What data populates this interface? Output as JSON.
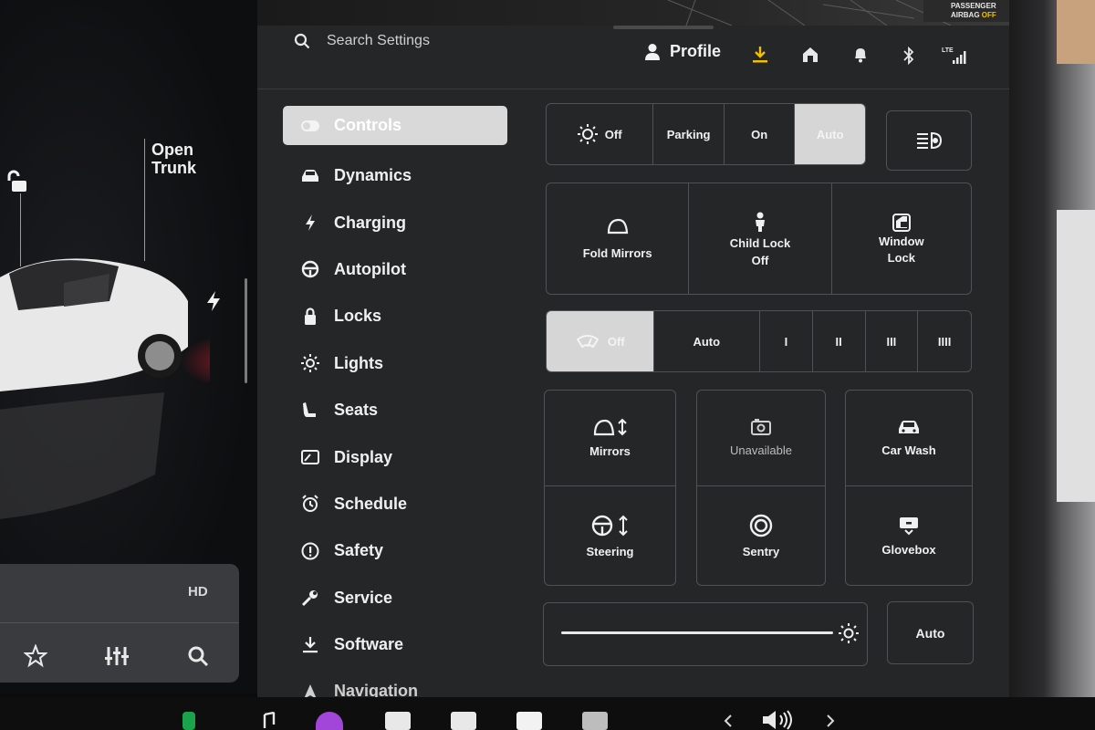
{
  "car_panel": {
    "trunk_label": "Open\nTrunk",
    "media": {
      "hd_label": "HD",
      "buttons": [
        "star-icon",
        "equalizer-icon",
        "search-icon"
      ]
    }
  },
  "airbag": {
    "line1": "PASSENGER",
    "line2_prefix": "AIRBAG",
    "line2_status": "OFF"
  },
  "search": {
    "placeholder": "Search Settings"
  },
  "profile": {
    "label": "Profile"
  },
  "status_icons": [
    "download-icon",
    "home-icon",
    "bell-icon",
    "bluetooth-icon",
    "lte-signal-icon"
  ],
  "colors": {
    "accent_yellow": "#f0c000",
    "selected": "#d6d6d6",
    "panel": "#252628"
  },
  "menu": {
    "items": [
      {
        "label": "Controls",
        "icon": "toggle-icon",
        "active": true
      },
      {
        "label": "Dynamics",
        "icon": "car-icon"
      },
      {
        "label": "Charging",
        "icon": "bolt-icon"
      },
      {
        "label": "Autopilot",
        "icon": "steering-wheel-icon"
      },
      {
        "label": "Locks",
        "icon": "lock-icon"
      },
      {
        "label": "Lights",
        "icon": "sun-icon"
      },
      {
        "label": "Seats",
        "icon": "seat-icon"
      },
      {
        "label": "Display",
        "icon": "display-icon"
      },
      {
        "label": "Schedule",
        "icon": "alarm-icon"
      },
      {
        "label": "Safety",
        "icon": "alert-icon"
      },
      {
        "label": "Service",
        "icon": "wrench-icon"
      },
      {
        "label": "Software",
        "icon": "download-icon"
      },
      {
        "label": "Navigation",
        "icon": "navigation-icon"
      }
    ]
  },
  "lights": {
    "options": [
      "Off",
      "Parking",
      "On",
      "Auto"
    ],
    "selected": "Auto"
  },
  "quick": {
    "fold_mirrors": "Fold Mirrors",
    "child_lock": "Child Lock",
    "child_lock_state": "Off",
    "window_lock_line1": "Window",
    "window_lock_line2": "Lock"
  },
  "wipers": {
    "options": [
      "Off",
      "Auto",
      "I",
      "II",
      "III",
      "IIII"
    ],
    "selected": "Off"
  },
  "grid": {
    "mirrors": "Mirrors",
    "unavailable": "Unavailable",
    "car_wash": "Car Wash",
    "steering": "Steering",
    "sentry": "Sentry",
    "glovebox": "Glovebox"
  },
  "brightness": {
    "level": 1.0,
    "auto_label": "Auto"
  }
}
